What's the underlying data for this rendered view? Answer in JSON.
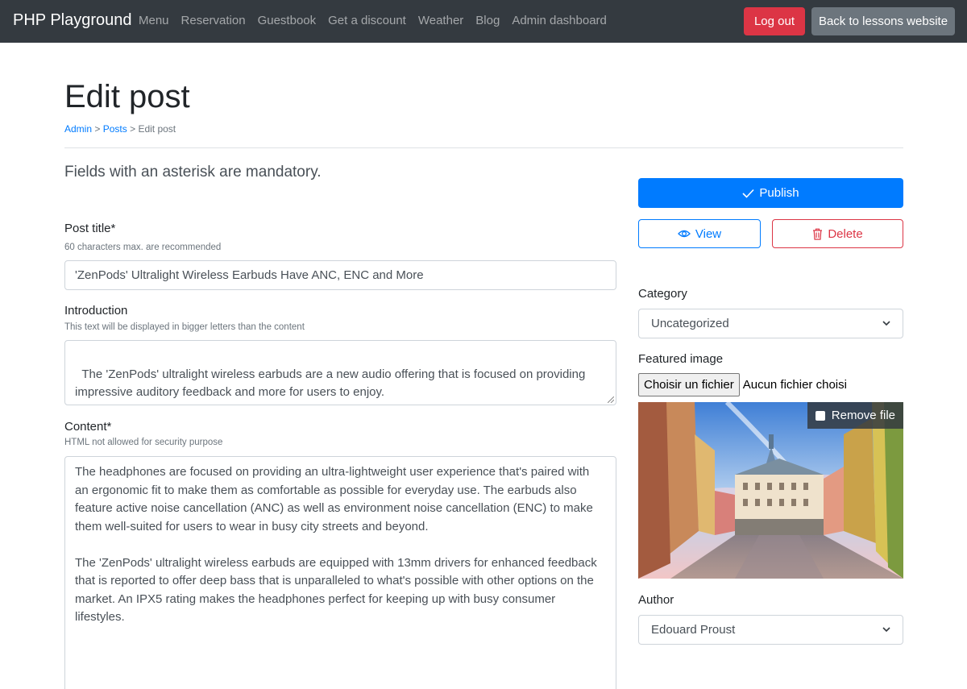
{
  "navbar": {
    "brand": "PHP Playground",
    "links": [
      "Menu",
      "Reservation",
      "Guestbook",
      "Get a discount",
      "Weather",
      "Blog",
      "Admin dashboard"
    ],
    "logout_label": "Log out",
    "back_label": "Back to lessons website"
  },
  "header": {
    "title": "Edit post",
    "breadcrumb": {
      "admin": "Admin",
      "posts": "Posts",
      "current": "Edit post",
      "separator": ">"
    }
  },
  "form": {
    "mandatory_note": "Fields with an asterisk are mandatory.",
    "post_title": {
      "label": "Post title*",
      "help": "60 characters max. are recommended",
      "value": "'ZenPods' Ultralight Wireless Earbuds Have ANC, ENC and More"
    },
    "introduction": {
      "label": "Introduction",
      "help": "This text will be displayed in bigger letters than the content",
      "value": "The 'ZenPods' ultralight wireless earbuds are a new audio offering that is focused on providing impressive auditory feedback and more for users to enjoy."
    },
    "content": {
      "label": "Content*",
      "help": "HTML not allowed for security purpose",
      "value": "The headphones are focused on providing an ultra-lightweight user experience that's paired with an ergonomic fit to make them as comfortable as possible for everyday use. The earbuds also feature active noise cancellation (ANC) as well as environment noise cancellation (ENC) to make them well-suited for users to wear in busy city streets and beyond.\n\nThe 'ZenPods' ultralight wireless earbuds are equipped with 13mm drivers for enhanced feedback that is reported to offer deep bass that is unparalleled to what's possible with other options on the market. An IPX5 rating makes the headphones perfect for keeping up with busy consumer lifestyles."
    }
  },
  "sidebar": {
    "publish_label": "Publish",
    "view_label": "View",
    "delete_label": "Delete",
    "category": {
      "label": "Category",
      "selected": "Uncategorized"
    },
    "featured_image": {
      "label": "Featured image",
      "choose_label": "Choisir un fichier",
      "no_file_label": "Aucun fichier choisi",
      "remove_label": "Remove file"
    },
    "author": {
      "label": "Author",
      "selected": "Edouard Proust"
    }
  },
  "colors": {
    "navbar": "#343a40",
    "primary": "#007bff",
    "danger": "#dc3545",
    "secondary": "#6c757d"
  }
}
